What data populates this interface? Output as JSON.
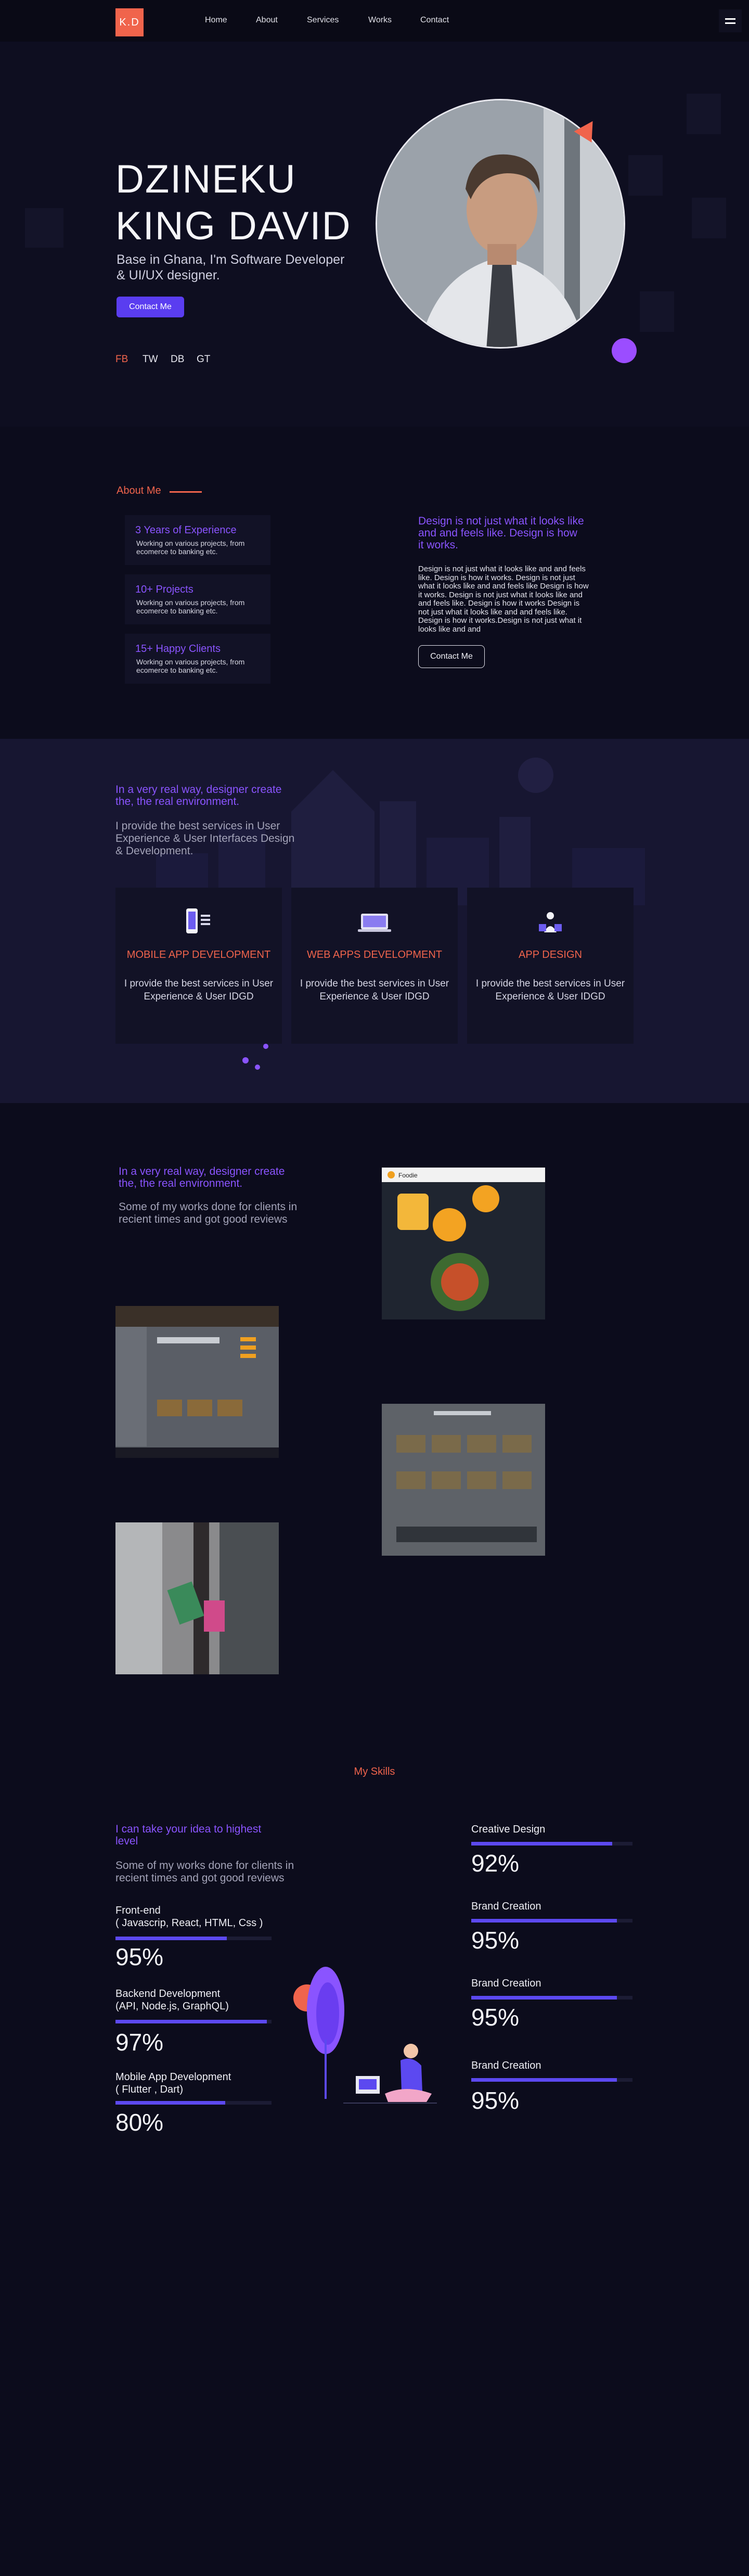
{
  "nav": {
    "logo": "K.D",
    "links": [
      "Home",
      "About",
      "Services",
      "Works",
      "Contact"
    ]
  },
  "hero": {
    "name_line1": "DZINEKU",
    "name_line2": "KING DAVID",
    "subtitle": "Base in Ghana, I'm Software Developer & UI/UX designer.",
    "contact_button": "Contact Me",
    "socials": [
      "FB",
      "TW",
      "DB",
      "GT"
    ]
  },
  "about": {
    "label": "About Me",
    "stats": [
      {
        "title": "3 Years of Experience",
        "desc": "Working on various projects, from ecomerce to banking etc."
      },
      {
        "title": "10+ Projects",
        "desc": "Working on various projects, from ecomerce to banking etc."
      },
      {
        "title": "15+ Happy Clients",
        "desc": "Working on various projects, from ecomerce to banking etc."
      }
    ],
    "heading": "Design is not just what it  looks like and and feels like. Design is how it works.",
    "paragraph": "Design is not just what it  looks like and and feels like. Design is how it works. Design is not just what it  looks like and and feels  like Design is how it works. Design is not just  what it  looks like and and feels like. Design is how it works Design is not just what  it  looks like and and feels like. Design is how it works.Design is not just what it  looks like and and",
    "button": "Contact Me"
  },
  "services": {
    "heading": "In a very real way, designer create the, the real environment.",
    "text": "I provide the best services in User Experience & User Interfaces Design & Development.",
    "cards": [
      {
        "title": "MOBILE APP DEVELOPMENT",
        "desc": "I provide the best services in User Experience & User IDGD",
        "icon": "mobile-icon"
      },
      {
        "title": "WEB APPS DEVELOPMENT",
        "desc": "I provide the best services in User Experience & User IDGD",
        "icon": "web-icon"
      },
      {
        "title": "APP DESIGN",
        "desc": "I provide the best services in User Experience & User IDGD",
        "icon": "design-icon"
      }
    ]
  },
  "works": {
    "heading": "In a very real way, designer create the, the real environment.",
    "text": "Some of my works done for clients in recient times and got good reviews",
    "foodie_brand": "Foodie"
  },
  "skills": {
    "title": "My Skills",
    "heading": "I can take your idea to highest level",
    "text": "Some of my works done for clients in recient times and got good reviews",
    "left": [
      {
        "label_line1": "Front-end",
        "label_line2": "( Javascrip, React,  HTML, Css )",
        "percent": "95%",
        "value": 95
      },
      {
        "label_line1": "Backend Development",
        "label_line2": "(API, Node.js, GraphQL)",
        "percent": "97%",
        "value": 97
      },
      {
        "label_line1": "Mobile App Development",
        "label_line2": "( Flutter , Dart)",
        "percent": "80%",
        "value": 80
      }
    ],
    "right": [
      {
        "label": "Creative Design",
        "percent": "92%",
        "value": 92
      },
      {
        "label": "Brand Creation",
        "percent": "95%",
        "value": 95
      },
      {
        "label": "Brand Creation",
        "percent": "95%",
        "value": 95
      },
      {
        "label": "Brand Creation",
        "percent": "95%",
        "value": 95
      }
    ]
  },
  "colors": {
    "accent": "#f0644c",
    "purple": "#8a54ff",
    "button": "#5a3df0",
    "background": "#0c0c1c"
  }
}
